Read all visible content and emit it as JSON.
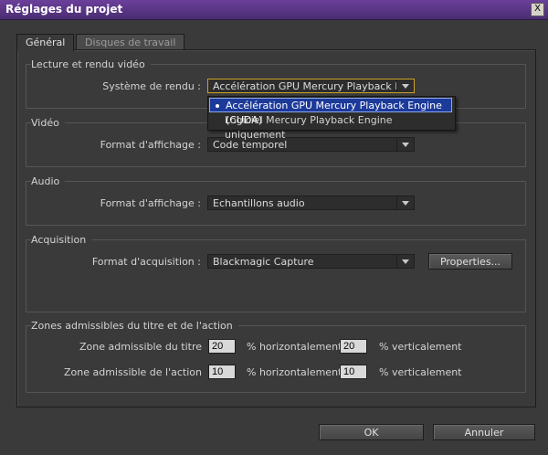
{
  "window": {
    "title": "Réglages du projet",
    "close_label": "X"
  },
  "tabs": [
    {
      "label": "Général",
      "active": true
    },
    {
      "label": "Disques de travail",
      "active": false
    }
  ],
  "playback": {
    "group_title": "Lecture et rendu vidéo",
    "renderer_label": "Système de rendu :",
    "renderer_value": "Accélération GPU Mercury Playback En...",
    "options": [
      "Accélération GPU Mercury Playback Engine (CUDA)",
      "Logiciel Mercury Playback Engine uniquement"
    ]
  },
  "video": {
    "group_title": "Vidéo",
    "format_label": "Format d'affichage :",
    "format_value": "Code temporel"
  },
  "audio": {
    "group_title": "Audio",
    "format_label": "Format d'affichage :",
    "format_value": "Echantillons audio"
  },
  "capture": {
    "group_title": "Acquisition",
    "format_label": "Format d'acquisition :",
    "format_value": "Blackmagic Capture",
    "properties_label": "Properties..."
  },
  "safe_zones": {
    "group_title": "Zones admissibles du titre et de l'action",
    "title_label": "Zone admissible du titre",
    "title_h": "20",
    "title_v": "20",
    "action_label": "Zone admissible de l'action",
    "action_h": "10",
    "action_v": "10",
    "h_label": "% horizontalement",
    "v_label": "% verticalement"
  },
  "buttons": {
    "ok": "OK",
    "cancel": "Annuler"
  }
}
